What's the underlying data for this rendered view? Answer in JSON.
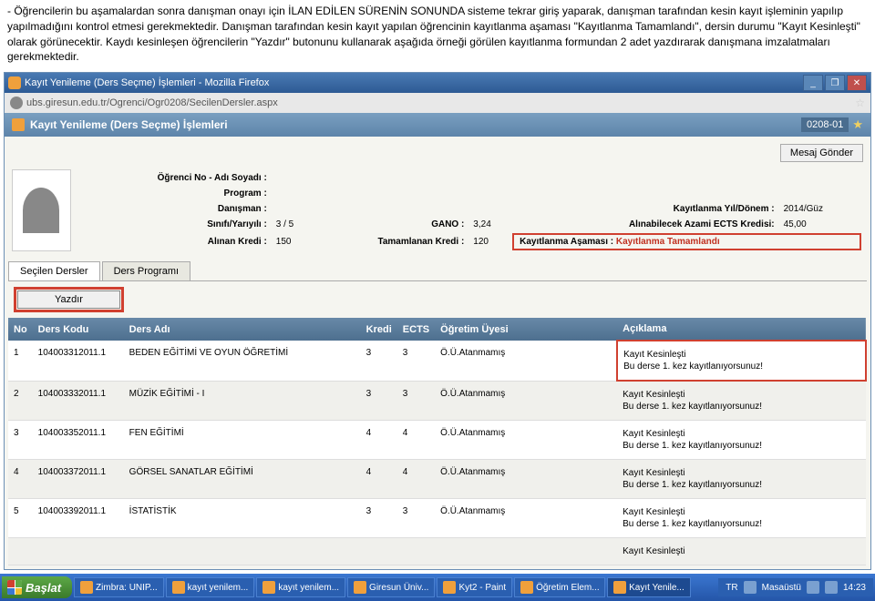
{
  "doc_paragraph_parts": [
    "- Öğrencilerin bu aşamalardan sonra   danışman onayı için İLAN EDİLEN SÜRENİN SONUNDA  sisteme tekrar giriş yaparak, danışman tarafından kesin kayıt işleminin yapılıp yapılmadığını kontrol etmesi gerekmektedir. Danışman tarafından kesin kayıt yapılan öğrencinin kayıtlanma aşaması \"Kayıtlanma Tamamlandı\", dersin durumu \"Kayıt Kesinleşti\" olarak görünecektir. Kaydı kesinleşen öğrencilerin \"Yazdır\" butonunu kullanarak aşağıda örneği görülen kayıtlanma formundan 2 adet yazdırarak danışmana imzalatmaları gerekmektedir."
  ],
  "window": {
    "title": "Kayıt Yenileme (Ders Seçme) İşlemleri - Mozilla Firefox",
    "url": "ubs.giresun.edu.tr/Ogrenci/Ogr0208/SecilenDersler.aspx"
  },
  "page_tab": {
    "title": "Kayıt Yenileme (Ders Seçme) İşlemleri",
    "code": "0208-01"
  },
  "actions": {
    "mesaj": "Mesaj Gönder"
  },
  "student": {
    "no_label": "Öğrenci No - Adı Soyadı :",
    "program_label": "Program :",
    "danisman_label": "Danışman :",
    "sinif_label": "Sınıfı/Yarıyılı :",
    "sinif_value": "3 / 5",
    "gano_label": "GANO :",
    "gano_value": "3,24",
    "kayit_yil_label": "Kayıtlanma Yıl/Dönem :",
    "kayit_yil_value": "2014/Güz",
    "alinabilecek_label": "Alınabilecek Azami ECTS Kredisi:",
    "alinabilecek_value": "45,00",
    "alinan_label": "Alınan Kredi :",
    "alinan_value": "150",
    "tamamlanan_label": "Tamamlanan Kredi :",
    "tamamlanan_value": "120",
    "asama_label": "Kayıtlanma Aşaması :",
    "asama_value": "Kayıtlanma Tamamlandı"
  },
  "tabs": {
    "secilen": "Seçilen Dersler",
    "program": "Ders Programı"
  },
  "yazdir_label": "Yazdır",
  "table": {
    "headers": {
      "no": "No",
      "kod": "Ders Kodu",
      "ad": "Ders Adı",
      "kredi": "Kredi",
      "ects": "ECTS",
      "uye": "Öğretim Üyesi",
      "acik": "Açıklama"
    },
    "rows": [
      {
        "no": "1",
        "kod": "104003312011.1",
        "ad": "BEDEN EĞİTİMİ VE OYUN ÖĞRETİMİ",
        "kredi": "3",
        "ects": "3",
        "uye": "Ö.Ü.Atanmamış",
        "acik": "Kayıt Kesinleşti\nBu derse 1. kez kayıtlanıyorsunuz!"
      },
      {
        "no": "2",
        "kod": "104003332011.1",
        "ad": "MÜZİK EĞİTİMİ - I",
        "kredi": "3",
        "ects": "3",
        "uye": "Ö.Ü.Atanmamış",
        "acik": "Kayıt Kesinleşti\nBu derse 1. kez kayıtlanıyorsunuz!"
      },
      {
        "no": "3",
        "kod": "104003352011.1",
        "ad": "FEN EĞİTİMİ",
        "kredi": "4",
        "ects": "4",
        "uye": "Ö.Ü.Atanmamış",
        "acik": "Kayıt Kesinleşti\nBu derse 1. kez kayıtlanıyorsunuz!"
      },
      {
        "no": "4",
        "kod": "104003372011.1",
        "ad": "GÖRSEL SANATLAR EĞİTİMİ",
        "kredi": "4",
        "ects": "4",
        "uye": "Ö.Ü.Atanmamış",
        "acik": "Kayıt Kesinleşti\nBu derse 1. kez kayıtlanıyorsunuz!"
      },
      {
        "no": "5",
        "kod": "104003392011.1",
        "ad": "İSTATİSTİK",
        "kredi": "3",
        "ects": "3",
        "uye": "Ö.Ü.Atanmamış",
        "acik": "Kayıt Kesinleşti\nBu derse 1. kez kayıtlanıyorsunuz!"
      }
    ],
    "partial_row": "Kayıt Kesinleşti"
  },
  "taskbar": {
    "start": "Başlat",
    "items": [
      "Zimbra: UNIP...",
      "kayıt yenilem...",
      "kayıt yenilem...",
      "Giresun Üniv...",
      "Kyt2 - Paint",
      "Öğretim Elem...",
      "Kayıt Yenile..."
    ],
    "tray_lang": "TR",
    "tray_status": "Masaüstü",
    "time": "14:23"
  }
}
